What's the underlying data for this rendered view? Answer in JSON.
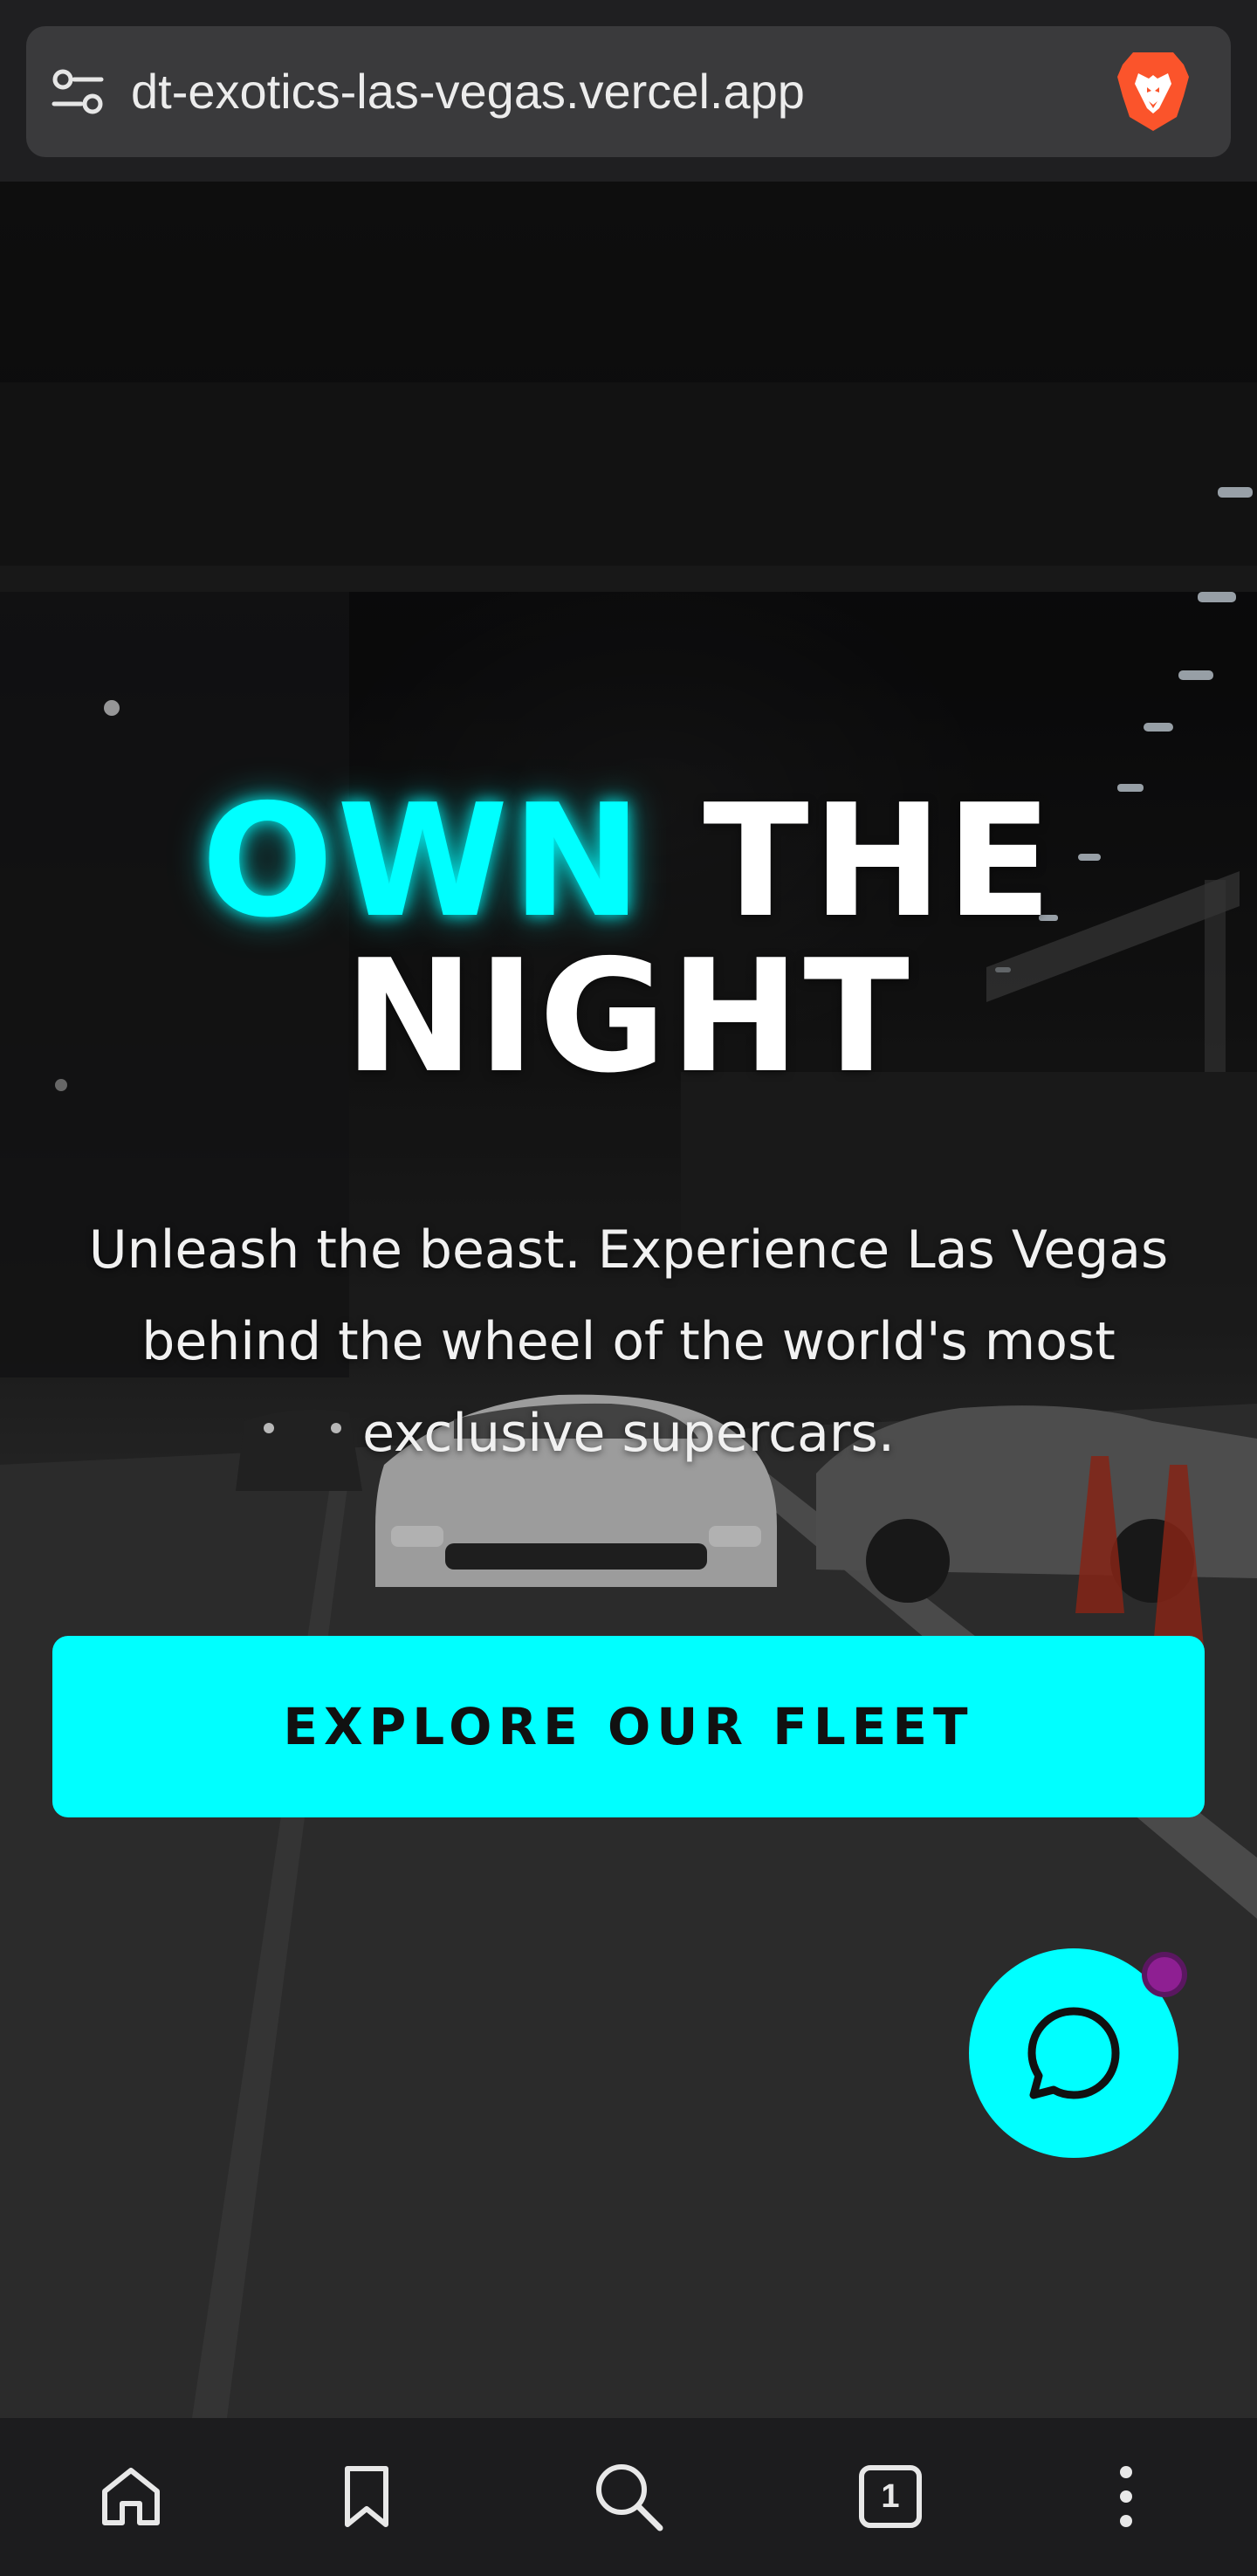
{
  "browser": {
    "url": "dt-exotics-las-vegas.vercel.app",
    "tab_count": "1"
  },
  "hero": {
    "headline_accent": "OWN",
    "headline_rest_line1": "THE",
    "headline_line2": "NIGHT",
    "subtitle": "Unleash the beast. Experience Las Vegas behind the wheel of the world's most exclusive supercars.",
    "cta_label": "EXPLORE OUR FLEET"
  },
  "colors": {
    "accent": "#00ffff",
    "chat_badge": "#8e1f92",
    "brave_orange": "#fb542b",
    "nav_bg": "#1c1c1e"
  },
  "icons": {
    "url_bar": [
      "site-settings-icon",
      "brave-lion-icon"
    ],
    "bottom_nav": [
      "home-icon",
      "bookmark-icon",
      "search-icon",
      "tabs-icon",
      "more-vertical-icon"
    ],
    "chat": "chat-bubble-icon"
  }
}
